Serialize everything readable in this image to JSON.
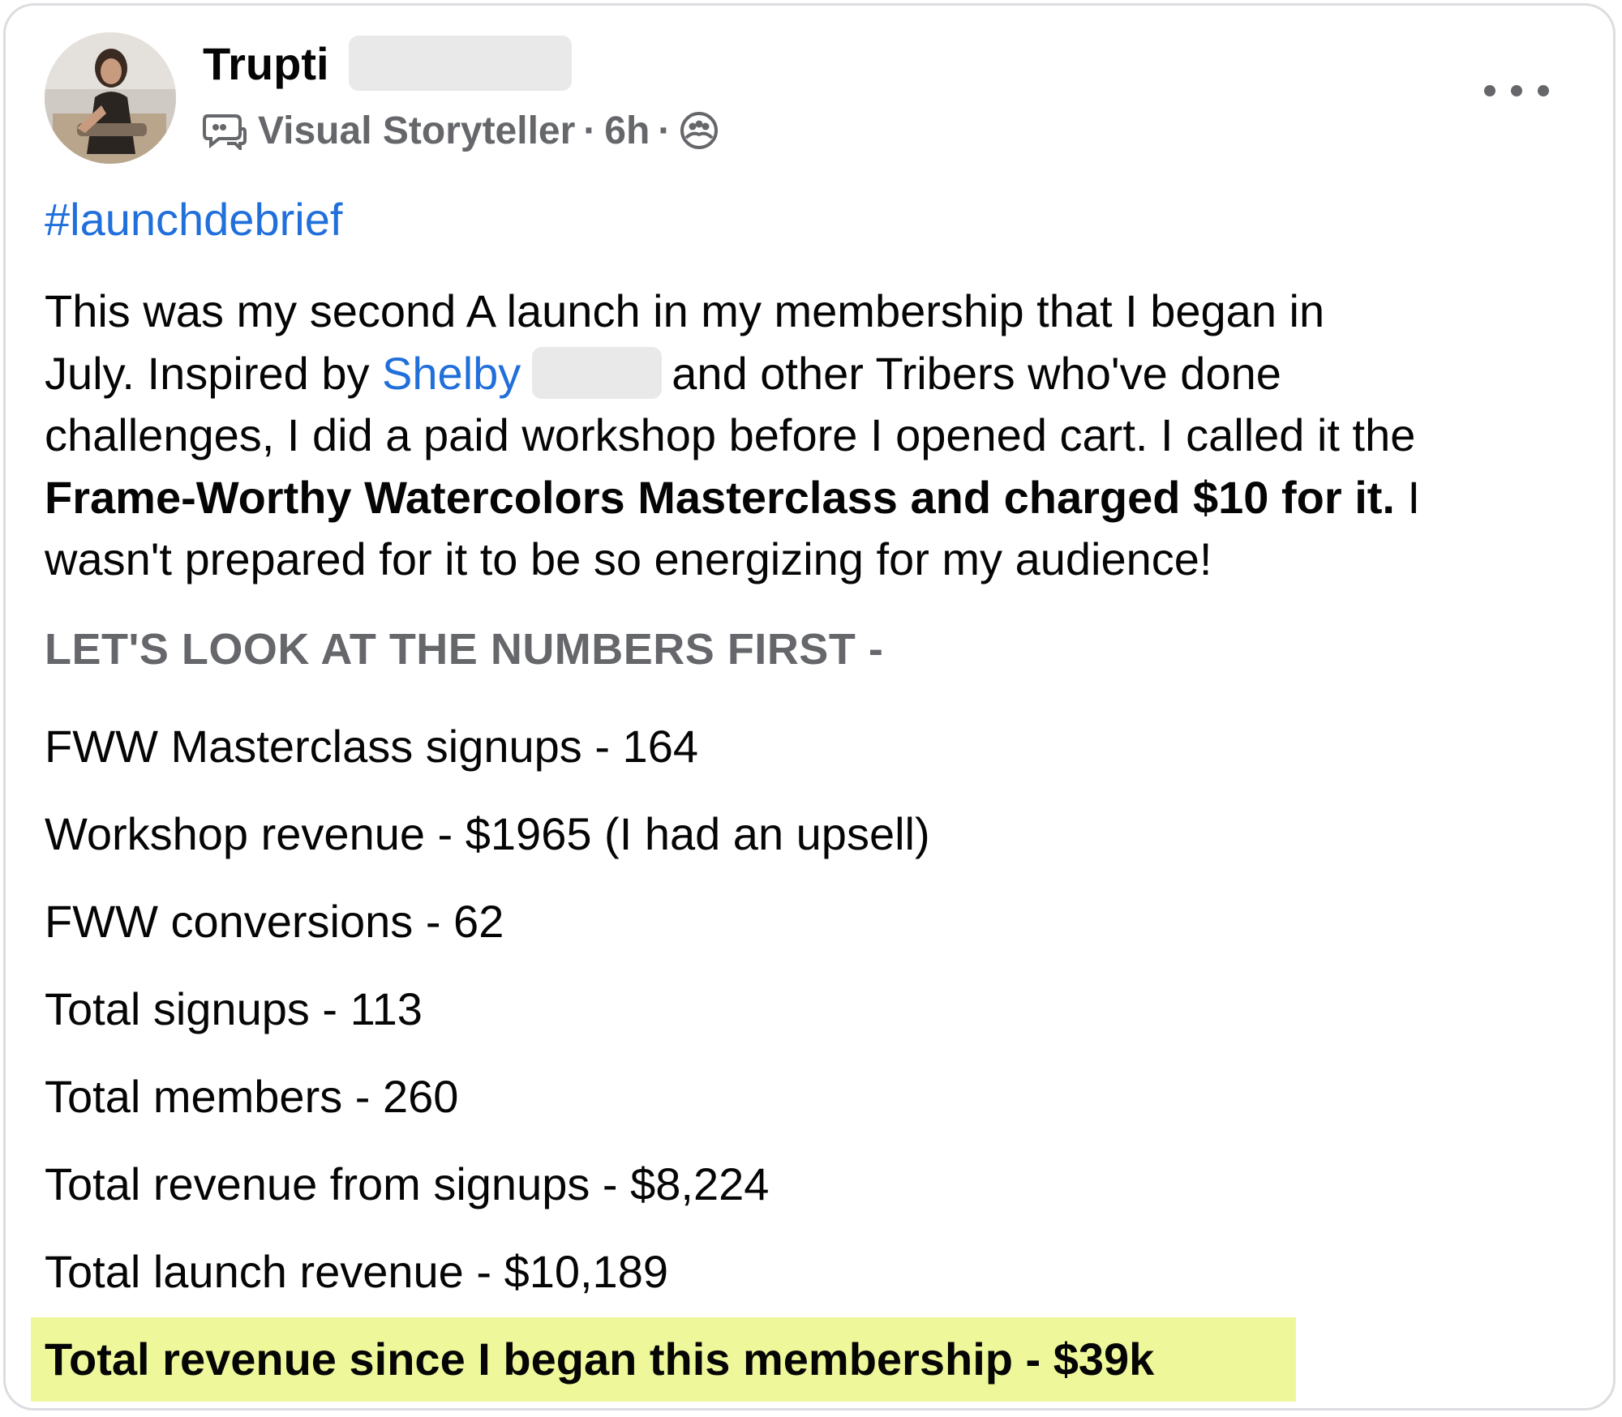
{
  "post": {
    "author_name": "Trupti",
    "author_badge": "Visual Storyteller",
    "timestamp": "6h",
    "meta_separator": "·",
    "privacy_icon": "group-icon",
    "badge_icon": "speech-bubble-icon",
    "more_icon": "more-options-icon",
    "hashtag": "#launchdebrief",
    "body": {
      "line1": "This was my second A launch in my membership that I began in",
      "line2_a": "July. Inspired by ",
      "line2_link": "Shelby",
      "line2_b": "and other Tribers who've done",
      "line3": "challenges, I did a paid workshop before I opened cart. I called it the",
      "line4_bold": "Frame-Worthy Watercolors Masterclass and charged $10 for it.",
      "line4_rest": " I",
      "line5": "wasn't prepared for it to be so energizing for my audience!"
    },
    "numbers_heading": "LET'S LOOK AT THE NUMBERS FIRST -",
    "stats": [
      "FWW Masterclass signups - 164",
      "Workshop revenue - $1965 (I had an upsell)",
      "FWW conversions - 62",
      "Total signups - 113",
      "Total members - 260",
      "Total revenue from signups - $8,224",
      "Total launch revenue - $10,189"
    ],
    "highlight_line": "Total revenue since I began this membership - $39k",
    "colors": {
      "link": "#216fdb",
      "secondary_text": "#65676b",
      "highlight": "#eef89a"
    }
  }
}
